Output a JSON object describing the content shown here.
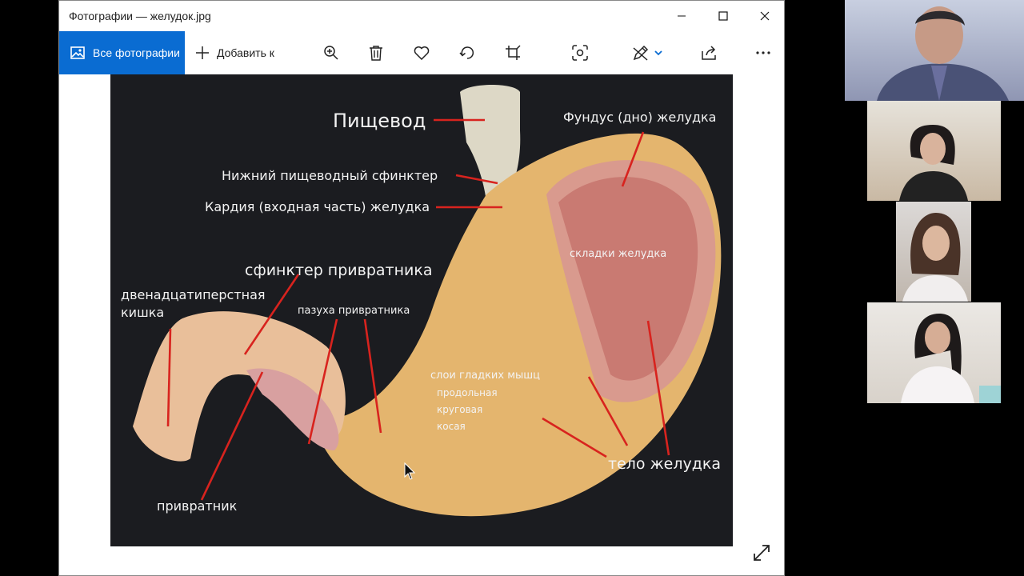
{
  "window": {
    "title": "Фотографии — желудок.jpg"
  },
  "toolbar": {
    "all_photos_label": "Все фотографии",
    "add_to_label": "Добавить к"
  },
  "image": {
    "labels": {
      "esophagus": "Пищевод",
      "fundus": "Фундус (дно) желудка",
      "lower_sphincter": "Нижний пищеводный сфинктер",
      "cardia": "Кардия (входная часть) желудка",
      "folds": "складки желудка",
      "pyloric_sphincter": "сфинктер привратника",
      "duodenum_line1": "двенадцатиперстная",
      "duodenum_line2": "кишка",
      "pyloric_antrum": "пазуха привратника",
      "muscle_layers": "слои гладких мышц",
      "longitudinal": "продольная",
      "circular": "круговая",
      "oblique": "косая",
      "body": "тело желудка",
      "pylorus": "привратник"
    }
  },
  "colors": {
    "accent": "#0a6cd2",
    "pointer_lines": "#d8231e",
    "photo_background": "#1b1c20"
  }
}
